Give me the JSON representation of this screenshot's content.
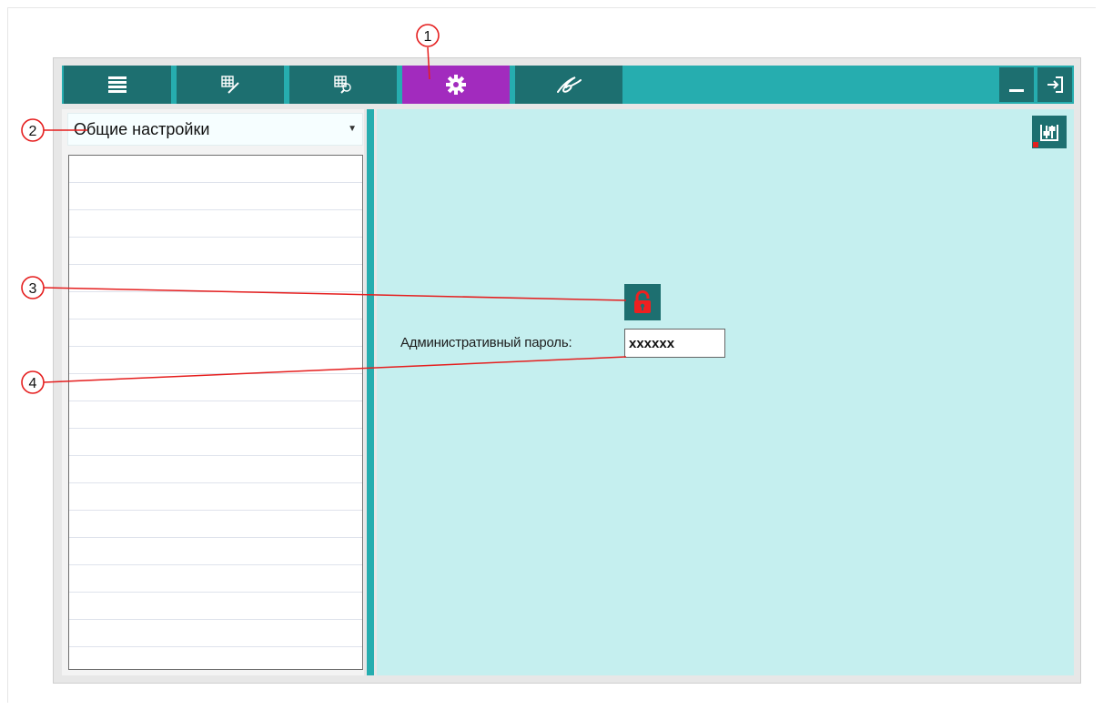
{
  "toolbar": {
    "tabs": [
      {
        "icon": "list-icon",
        "active": false
      },
      {
        "icon": "edit-grid-icon",
        "active": false
      },
      {
        "icon": "search-grid-icon",
        "active": false
      },
      {
        "icon": "gear-icon",
        "active": true
      },
      {
        "icon": "signature-icon",
        "active": false
      }
    ],
    "minimize_icon": "minimize-icon",
    "exit_icon": "exit-icon"
  },
  "sidebar": {
    "category_select_value": "Общие настройки"
  },
  "content": {
    "admin_password_label": "Административный пароль:",
    "admin_password_value": "xxxxxx",
    "lock_icon": "lock-icon",
    "settings_icon": "sliders-icon"
  },
  "annotations": [
    "1",
    "2",
    "3",
    "4"
  ],
  "colors": {
    "toolbar_bg": "#26ADAF",
    "tab_bg": "#1D6F70",
    "tab_active_bg": "#A22BBE",
    "content_bg": "#C5EFEF",
    "annotation_line": "#E51E1E"
  }
}
